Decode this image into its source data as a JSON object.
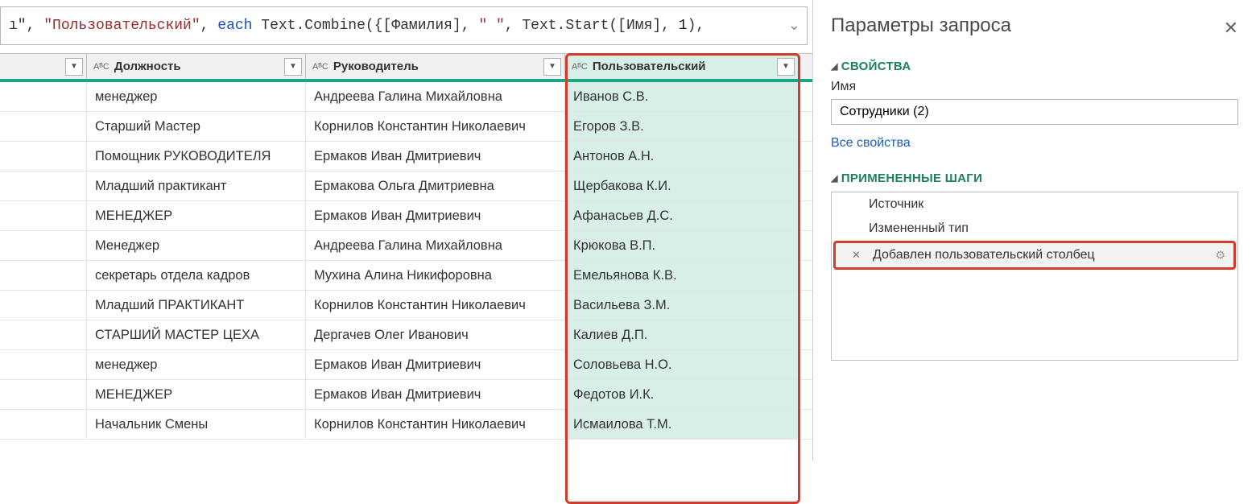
{
  "formula": {
    "prefix_literal": "ı\", ",
    "str1": "\"Пользовательский\"",
    "sep1": ", ",
    "kw": "each",
    "func": " Text.Combine({[Фамилия], ",
    "str2": "\" \"",
    "sep2": ", Text.Start([Имя], ",
    "num": "1",
    "tail": "),"
  },
  "table": {
    "headers": {
      "c2": "Должность",
      "c3": "Руководитель",
      "c4": "Пользовательский"
    },
    "rows": [
      {
        "c1": "",
        "c2": "менеджер",
        "c3": "Андреева Галина Михайловна",
        "c4": "Иванов С.В."
      },
      {
        "c1": "",
        "c2": "Старший Мастер",
        "c3": "Корнилов Константин Николаевич",
        "c4": "Егоров З.В."
      },
      {
        "c1": "",
        "c2": "Помощник РУКОВОДИТЕЛЯ",
        "c3": "Ермаков Иван Дмитриевич",
        "c4": "Антонов А.Н."
      },
      {
        "c1": "",
        "c2": "Младший практикант",
        "c3": "Ермакова Ольга Дмитриевна",
        "c4": "Щербакова К.И."
      },
      {
        "c1": "",
        "c2": "МЕНЕДЖЕР",
        "c3": "Ермаков Иван Дмитриевич",
        "c4": "Афанасьев Д.С."
      },
      {
        "c1": "",
        "c2": "Менеджер",
        "c3": "Андреева Галина Михайловна",
        "c4": "Крюкова В.П."
      },
      {
        "c1": "",
        "c2": "секретарь отдела кадров",
        "c3": "Мухина Алина Никифоровна",
        "c4": "Емельянова К.В."
      },
      {
        "c1": "",
        "c2": "Младший ПРАКТИКАНТ",
        "c3": "Корнилов Константин Николаевич",
        "c4": "Васильева З.М."
      },
      {
        "c1": "",
        "c2": "СТАРШИЙ МАСТЕР ЦЕХА",
        "c3": "Дергачев Олег Иванович",
        "c4": "Калиев Д.П."
      },
      {
        "c1": "",
        "c2": "менеджер",
        "c3": "Ермаков Иван Дмитриевич",
        "c4": "Соловьева Н.О."
      },
      {
        "c1": "",
        "c2": "МЕНЕДЖЕР",
        "c3": "Ермаков Иван Дмитриевич",
        "c4": "Федотов И.К."
      },
      {
        "c1": "",
        "c2": "Начальник Смены",
        "c3": "Корнилов Константин Николаевич",
        "c4": "Исмаилова Т.М."
      }
    ]
  },
  "side": {
    "title": "Параметры запроса",
    "props_hdr": "СВОЙСТВА",
    "name_label": "Имя",
    "name_value": "Сотрудники (2)",
    "all_props_link": "Все свойства",
    "steps_hdr": "ПРИМЕНЕННЫЕ ШАГИ",
    "steps": [
      {
        "label": "Источник",
        "selected": false
      },
      {
        "label": "Измененный тип",
        "selected": false
      },
      {
        "label": "Добавлен пользовательский столбец",
        "selected": true
      }
    ]
  },
  "icons": {
    "type": "AᴮC",
    "filter_dn": "▼",
    "chev": "⌄",
    "tri": "◢",
    "close": "✕",
    "del": "✕",
    "gear": "⚙"
  }
}
